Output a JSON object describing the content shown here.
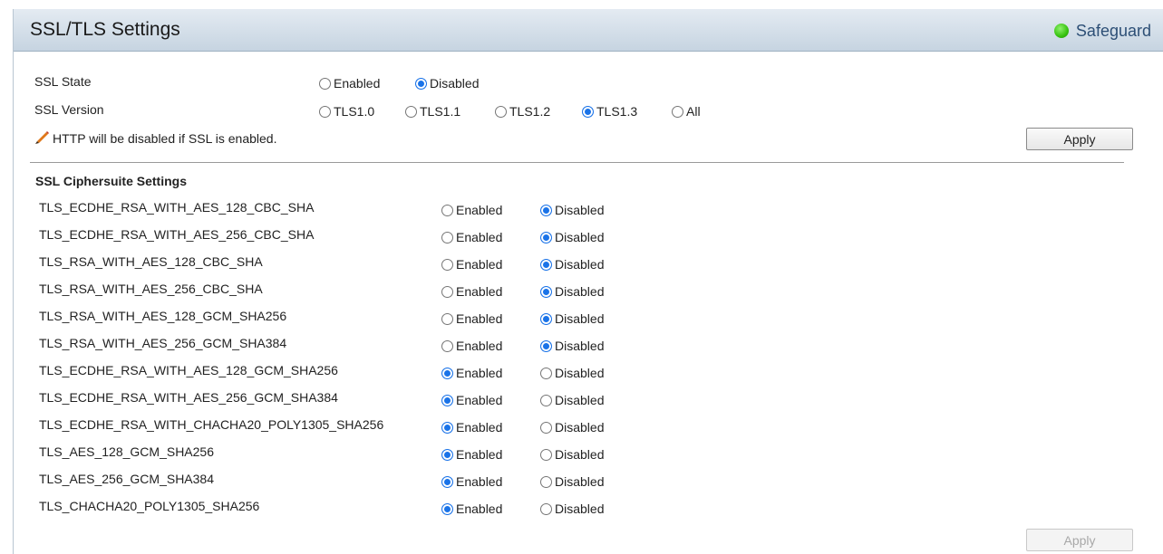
{
  "header": {
    "title": "SSL/TLS Settings",
    "safeguard_label": "Safeguard",
    "safeguard_color": "#36c20f"
  },
  "ssl_state": {
    "label": "SSL State",
    "options": [
      {
        "label": "Enabled",
        "checked": false
      },
      {
        "label": "Disabled",
        "checked": true
      }
    ]
  },
  "ssl_version": {
    "label": "SSL Version",
    "options": [
      {
        "label": "TLS1.0",
        "checked": false
      },
      {
        "label": "TLS1.1",
        "checked": false
      },
      {
        "label": "TLS1.2",
        "checked": false
      },
      {
        "label": "TLS1.3",
        "checked": true
      },
      {
        "label": "All",
        "checked": false
      }
    ]
  },
  "note": {
    "text": "HTTP will be disabled if SSL is enabled.",
    "icon": "pencil-icon"
  },
  "apply_top": {
    "label": "Apply",
    "enabled": true
  },
  "ciphers": {
    "section_title": "SSL Ciphersuite Settings",
    "enabled_label": "Enabled",
    "disabled_label": "Disabled",
    "rows": [
      {
        "name": "TLS_ECDHE_RSA_WITH_AES_128_CBC_SHA",
        "enabled": false
      },
      {
        "name": "TLS_ECDHE_RSA_WITH_AES_256_CBC_SHA",
        "enabled": false
      },
      {
        "name": "TLS_RSA_WITH_AES_128_CBC_SHA",
        "enabled": false
      },
      {
        "name": "TLS_RSA_WITH_AES_256_CBC_SHA",
        "enabled": false
      },
      {
        "name": "TLS_RSA_WITH_AES_128_GCM_SHA256",
        "enabled": false
      },
      {
        "name": "TLS_RSA_WITH_AES_256_GCM_SHA384",
        "enabled": false
      },
      {
        "name": "TLS_ECDHE_RSA_WITH_AES_128_GCM_SHA256",
        "enabled": true
      },
      {
        "name": "TLS_ECDHE_RSA_WITH_AES_256_GCM_SHA384",
        "enabled": true
      },
      {
        "name": "TLS_ECDHE_RSA_WITH_CHACHA20_POLY1305_SHA256",
        "enabled": true
      },
      {
        "name": "TLS_AES_128_GCM_SHA256",
        "enabled": true
      },
      {
        "name": "TLS_AES_256_GCM_SHA384",
        "enabled": true
      },
      {
        "name": "TLS_CHACHA20_POLY1305_SHA256",
        "enabled": true
      }
    ]
  },
  "apply_bottom": {
    "label": "Apply",
    "enabled": false
  }
}
